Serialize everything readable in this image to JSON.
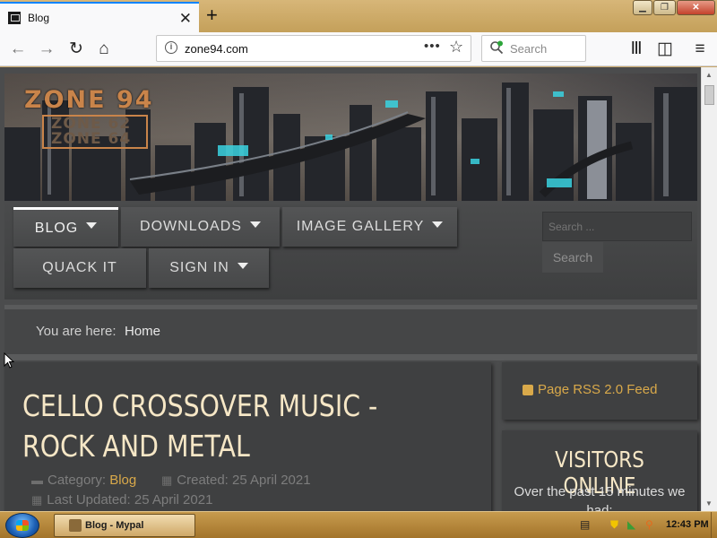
{
  "browser": {
    "tab_title": "Blog",
    "new_tab_icon": "plus-icon",
    "url": "zone94.com",
    "search_placeholder": "Search",
    "window_controls": [
      "minimize-icon",
      "maximize-icon",
      "close-icon"
    ]
  },
  "site": {
    "logo_main": "ZONE 94",
    "logo_sub_1": "ZONE 62",
    "logo_sub_2": "ZONE 64",
    "menu": [
      {
        "label": "BLOG",
        "has_dropdown": true,
        "active": true
      },
      {
        "label": "DOWNLOADS",
        "has_dropdown": true,
        "active": false
      },
      {
        "label": "IMAGE GALLERY",
        "has_dropdown": true,
        "active": false
      },
      {
        "label": "QUACK IT",
        "has_dropdown": false,
        "active": false
      },
      {
        "label": "SIGN IN",
        "has_dropdown": true,
        "active": false
      }
    ],
    "search_placeholder": "Search ...",
    "search_button": "Search",
    "breadcrumb_label": "You are here:",
    "breadcrumb_home": "Home",
    "article": {
      "title": "CELLO CROSSOVER MUSIC - ROCK AND METAL",
      "category_label": "Category:",
      "category_value": "Blog",
      "created": "Created: 25 April 2021",
      "last_updated": "Last Updated: 25 April 2021"
    },
    "rss_label": "Page RSS 2.0 Feed",
    "visitors_title": "VISITORS ONLINE",
    "visitors_text": "Over the past 15 minutes we had:"
  },
  "taskbar": {
    "task_label": "Blog - Mypal",
    "clock": "12:43 PM"
  },
  "colors": {
    "accent": "#d9a94a",
    "title_text": "#f6e7c6",
    "panel": "#3f4041",
    "page_bg": "#4b4c4d"
  }
}
